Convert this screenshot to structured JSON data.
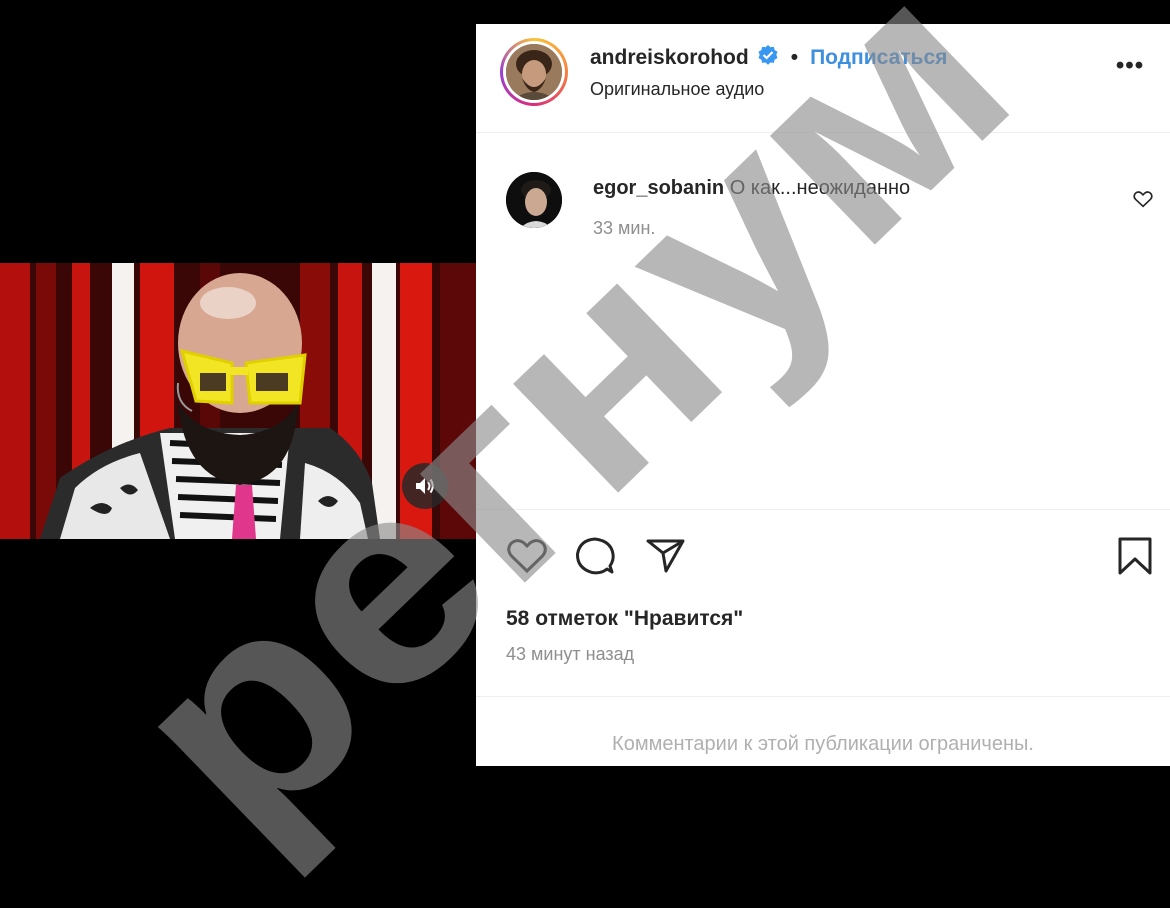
{
  "post": {
    "username": "andreiskorohod",
    "separator": "•",
    "follow_label": "Подписаться",
    "audio_label": "Оригинальное аудио",
    "more_label": "•••"
  },
  "comment": {
    "username": "egor_sobanin",
    "text": " О как...неожиданно",
    "time": "33 мин."
  },
  "likes_text": "58 отметок \"Нравится\"",
  "time_ago": "43 минут назад",
  "comments_restricted": "Комментарии к этой публикации ограничены.",
  "watermark": "регнум",
  "colors": {
    "follow": "#3d8fe0",
    "verified": "#3897f0",
    "glasses": "#f2e624",
    "stage_red": "#c8140e"
  },
  "icons": [
    "verified-badge-icon",
    "more-options-icon",
    "heart-icon",
    "comment-icon",
    "share-icon",
    "bookmark-icon",
    "volume-icon"
  ]
}
